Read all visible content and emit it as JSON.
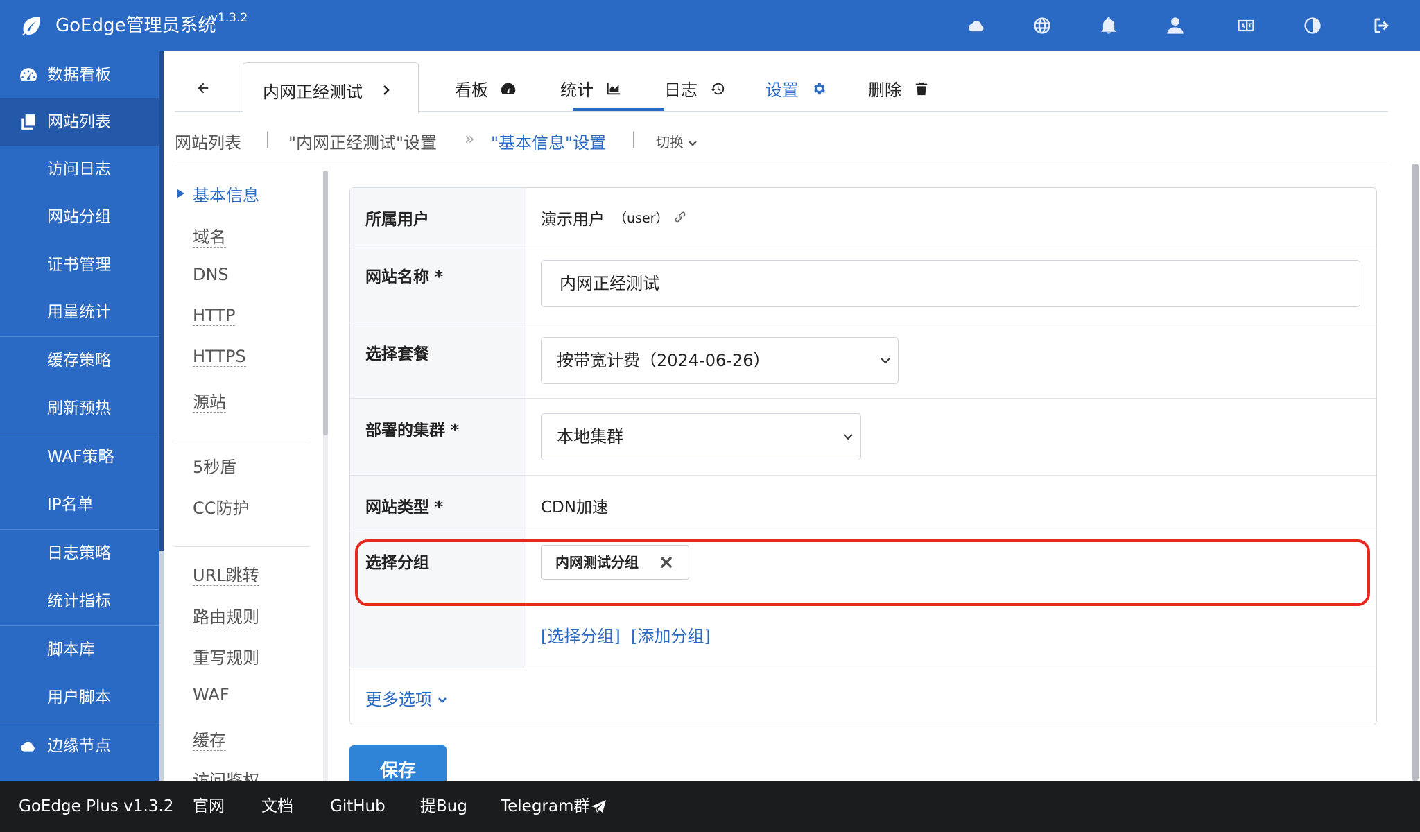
{
  "app": {
    "title": "GoEdge管理员系统",
    "version": "v1.3.2"
  },
  "top_icons": [
    "cloud-icon",
    "globe-icon",
    "bell-icon",
    "user-icon",
    "language-icon",
    "contrast-icon",
    "logout-icon"
  ],
  "sidebar": {
    "items": [
      {
        "label": "数据看板",
        "icon": "dashboard-icon"
      },
      {
        "label": "网站列表",
        "icon": "copy-icon",
        "active": true
      },
      {
        "label": "访问日志"
      },
      {
        "label": "网站分组"
      },
      {
        "label": "证书管理"
      },
      {
        "label": "用量统计"
      },
      {
        "label": "缓存策略"
      },
      {
        "label": "刷新预热"
      },
      {
        "label": "WAF策略"
      },
      {
        "label": "IP名单"
      },
      {
        "label": "日志策略"
      },
      {
        "label": "统计指标"
      },
      {
        "label": "脚本库"
      },
      {
        "label": "用户脚本"
      },
      {
        "label": "边缘节点",
        "icon": "cloud-icon"
      }
    ]
  },
  "tabs": {
    "site": "内网正经测试",
    "items": [
      {
        "label": "看板",
        "icon": "dashboard-icon"
      },
      {
        "label": "统计",
        "icon": "area-chart-icon"
      },
      {
        "label": "日志",
        "icon": "history-icon"
      },
      {
        "label": "设置",
        "icon": "gear-icon",
        "active": true
      },
      {
        "label": "删除",
        "icon": "trash-icon"
      }
    ]
  },
  "breadcrumb": {
    "items": [
      "网站列表",
      "\"内网正经测试\"设置",
      "\"基本信息\"设置"
    ],
    "separators": [
      "|",
      "»",
      "|"
    ],
    "switch": "切换"
  },
  "submenu": {
    "items": [
      "基本信息",
      "域名",
      "DNS",
      "HTTP",
      "HTTPS",
      "源站",
      "5秒盾",
      "CC防护",
      "URL跳转",
      "路由规则",
      "重写规则",
      "WAF",
      "缓存",
      "访问鉴权"
    ]
  },
  "form": {
    "owner": {
      "label": "所属用户",
      "value": "演示用户",
      "username": "（user）"
    },
    "site_name": {
      "label": "网站名称 *",
      "value": "内网正经测试"
    },
    "plan": {
      "label": "选择套餐",
      "value": "按带宽计费（2024-06-26）"
    },
    "cluster": {
      "label": "部署的集群 *",
      "value": "本地集群"
    },
    "site_type": {
      "label": "网站类型 *",
      "value": "CDN加速"
    },
    "group": {
      "label": "选择分组",
      "chip": "内网测试分组",
      "select_link": "[选择分组]",
      "add_link": "[添加分组]"
    },
    "more_options": "更多选项"
  },
  "save_button": "保存",
  "footer": {
    "items": [
      "GoEdge Plus v1.3.2",
      "官网",
      "文档",
      "GitHub",
      "提Bug",
      "Telegram群"
    ]
  },
  "colors": {
    "brand": "#2a6ac4",
    "highlight": "#e8281e",
    "footer": "#1b1c1d"
  }
}
